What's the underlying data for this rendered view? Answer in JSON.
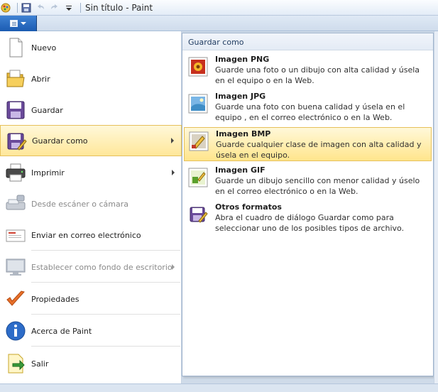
{
  "window": {
    "title": "Sin título - Paint"
  },
  "qat": {
    "icons": [
      "paint-app-icon",
      "save-icon",
      "undo-icon",
      "redo-icon",
      "customize-arrow-icon"
    ]
  },
  "menu": {
    "items": [
      {
        "label": "Nuevo",
        "icon": "new-document-icon",
        "enabled": true,
        "submenu": false
      },
      {
        "label": "Abrir",
        "icon": "open-folder-icon",
        "enabled": true,
        "submenu": false
      },
      {
        "label": "Guardar",
        "icon": "save-disk-icon",
        "enabled": true,
        "submenu": false
      },
      {
        "label": "Guardar como",
        "icon": "save-as-icon",
        "enabled": true,
        "submenu": true,
        "highlighted": true
      },
      {
        "label": "Imprimir",
        "icon": "printer-icon",
        "enabled": true,
        "submenu": true
      },
      {
        "label": "Desde escáner o cámara",
        "icon": "scanner-icon",
        "enabled": false,
        "submenu": false
      },
      {
        "label": "Enviar en correo electrónico",
        "icon": "email-icon",
        "enabled": true,
        "submenu": false
      },
      {
        "label": "Establecer como fondo de escritorio",
        "icon": "desktop-background-icon",
        "enabled": false,
        "submenu": true
      },
      {
        "label": "Propiedades",
        "icon": "checkmark-icon",
        "enabled": true,
        "submenu": false
      },
      {
        "label": "Acerca de Paint",
        "icon": "info-icon",
        "enabled": true,
        "submenu": false
      },
      {
        "label": "Salir",
        "icon": "exit-icon",
        "enabled": true,
        "submenu": false
      }
    ]
  },
  "submenu": {
    "header": "Guardar como",
    "options": [
      {
        "title": "Imagen PNG",
        "desc": "Guarde una foto o un dibujo con alta calidad y úsela en el equipo o en la Web.",
        "icon": "png-image-icon"
      },
      {
        "title": "Imagen JPG",
        "desc": "Guarde una foto con buena calidad y úsela en el equipo , en el correo electrónico o en la Web.",
        "icon": "jpg-image-icon"
      },
      {
        "title": "Imagen BMP",
        "desc": "Guarde cualquier clase de imagen con alta calidad y úsela en el equipo.",
        "icon": "bmp-image-icon",
        "highlighted": true
      },
      {
        "title": "Imagen GIF",
        "desc": "Guarde un dibujo sencillo con menor calidad y úselo en el correo electrónico o en la Web.",
        "icon": "gif-image-icon"
      },
      {
        "title": "Otros formatos",
        "desc": "Abra el cuadro de diálogo Guardar como para seleccionar uno de los posibles tipos de archivo.",
        "icon": "other-formats-icon"
      }
    ]
  },
  "colors": {
    "highlight": "#ffe79a",
    "app_button": "#2a6cc4"
  }
}
